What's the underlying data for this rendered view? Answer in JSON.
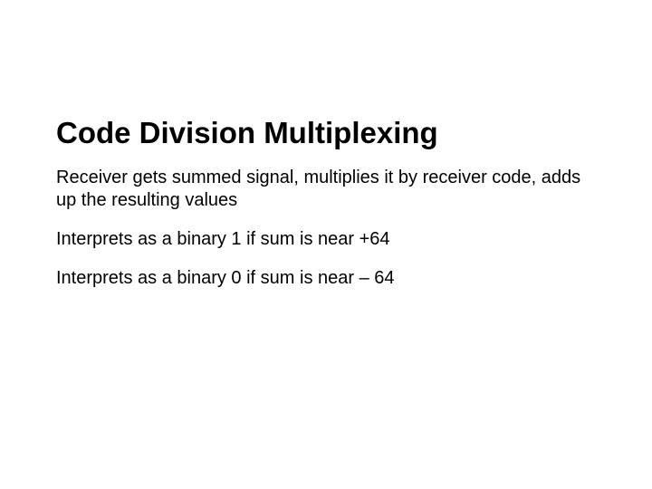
{
  "slide": {
    "title": "Code Division Multiplexing",
    "paragraphs": [
      "Receiver gets summed signal, multiplies it by receiver code, adds up the resulting values",
      "Interprets as a binary 1 if sum is near +64",
      "Interprets as a binary 0 if sum is near – 64"
    ]
  }
}
